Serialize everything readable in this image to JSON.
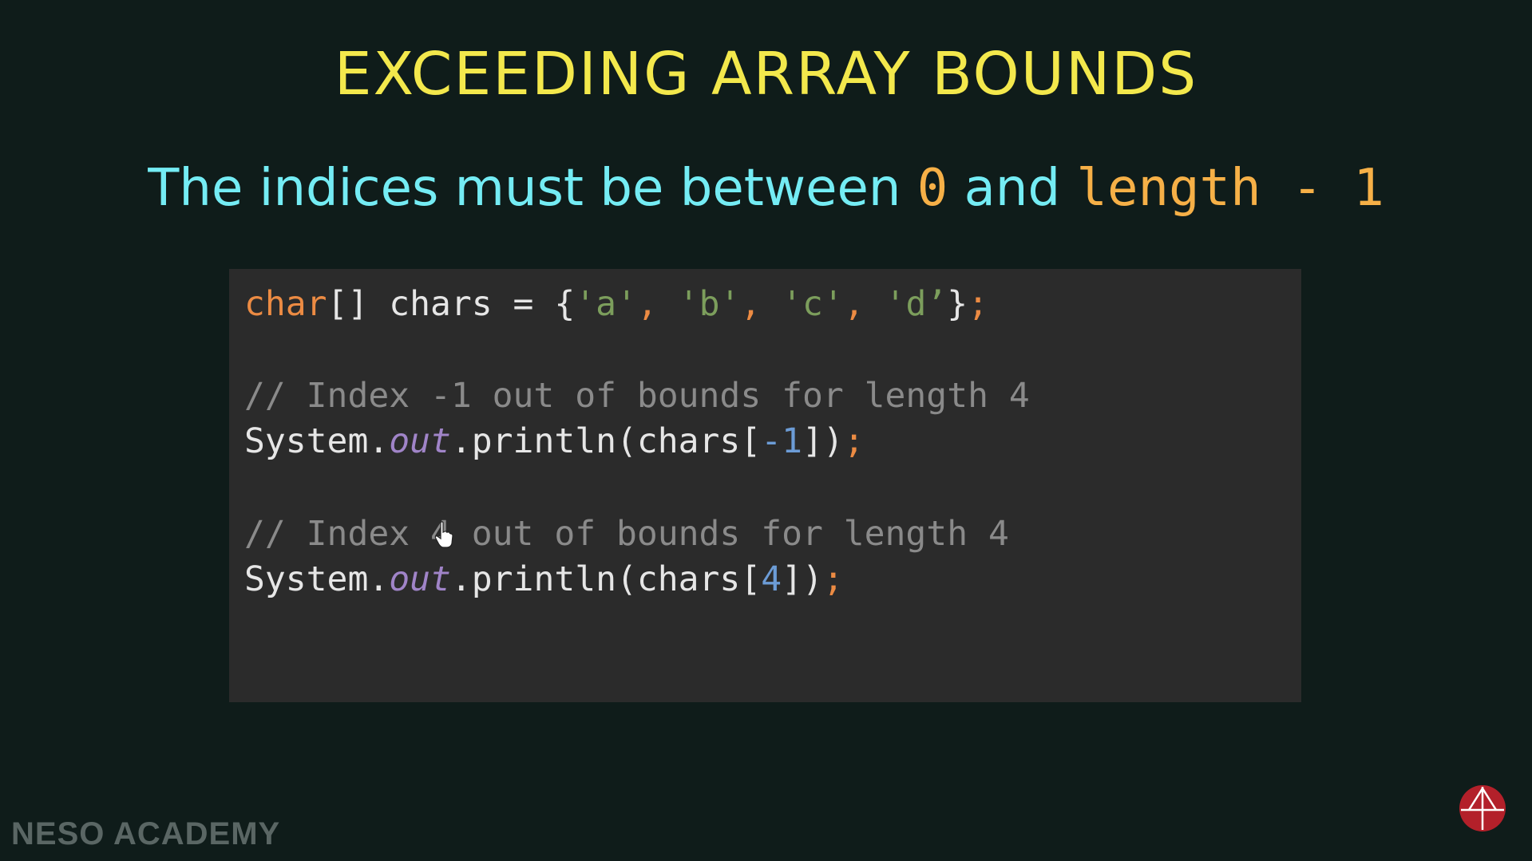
{
  "slide": {
    "title": "EXCEEDING ARRAY BOUNDS",
    "subtitle": {
      "part1": "The indices must be between ",
      "zero": "0",
      "part2": " and ",
      "length_expr": "length - 1"
    }
  },
  "code": {
    "line1": {
      "type": "char",
      "decl": "[] chars = {",
      "a": "'a'",
      "comma1": ", ",
      "b": "'b'",
      "comma2": ", ",
      "c": "'c'",
      "comma3": ", ",
      "d": "'d’",
      "close": "}",
      "semi": ";"
    },
    "comment1": "// Index -1 out of bounds for length 4",
    "line2": {
      "sys": "System.",
      "out": "out",
      "call": ".println(chars[",
      "idx": "-1",
      "close": "])",
      "semi": ";"
    },
    "comment2": "// Index 4 out of bounds for length 4",
    "line3": {
      "sys": "System.",
      "out": "out",
      "call": ".println(chars[",
      "idx": "4",
      "close": "])",
      "semi": ";"
    }
  },
  "watermark": "NESO ACADEMY",
  "logo_icon": "neso-academy-logo-icon",
  "cursor_icon": "hand-cursor-icon",
  "colors": {
    "background": "#0f1c1a",
    "title": "#f3e84c",
    "subtitle": "#74ecf4",
    "highlight": "#f6b047",
    "code_panel": "#2b2b2b",
    "logo": "#b3202a"
  }
}
